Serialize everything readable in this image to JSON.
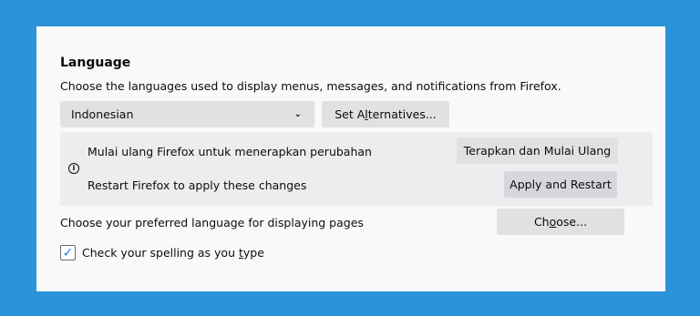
{
  "language_section": {
    "heading": "Language",
    "description": "Choose the languages used to display menus, messages, and notifications from Firefox.",
    "language_select": {
      "selected": "Indonesian",
      "icon": "chevron-down-icon"
    },
    "set_alternatives_button": {
      "pre": "Set A",
      "access": "l",
      "post": "ternatives..."
    }
  },
  "restart_notice": {
    "icon": "info-icon",
    "message_localized": "Mulai ulang Firefox untuk menerapkan perubahan",
    "button_localized": "Terapkan dan Mulai Ulang",
    "message_english": "Restart Firefox to apply these changes",
    "button_english": "Apply and Restart"
  },
  "page_language": {
    "text": "Choose your preferred language for displaying pages",
    "choose_button": {
      "pre": "Ch",
      "access": "o",
      "post": "ose..."
    }
  },
  "spellcheck": {
    "checked": true,
    "label_pre": "Check your spelling as you ",
    "label_access": "t",
    "label_post": "ype"
  },
  "colors": {
    "background": "#2b93d9",
    "panel": "#f9f9fa",
    "notice": "#ededf0",
    "button": "#e1e1e2",
    "check_accent": "#0a84ff"
  }
}
